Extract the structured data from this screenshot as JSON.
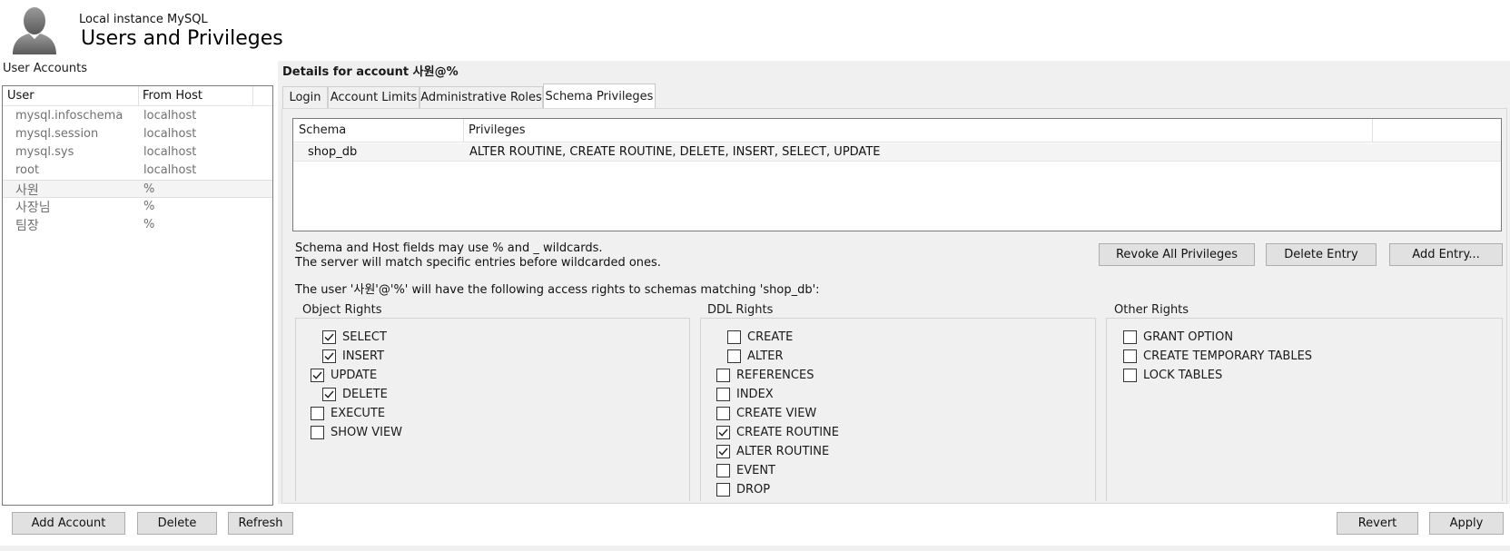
{
  "header": {
    "instance": "Local instance MySQL",
    "title": "Users and Privileges"
  },
  "accounts": {
    "label": "User Accounts",
    "columns": [
      "User",
      "From Host"
    ],
    "rows": [
      {
        "user": "mysql.infoschema",
        "host": "localhost",
        "selected": false
      },
      {
        "user": "mysql.session",
        "host": "localhost",
        "selected": false
      },
      {
        "user": "mysql.sys",
        "host": "localhost",
        "selected": false
      },
      {
        "user": "root",
        "host": "localhost",
        "selected": false
      },
      {
        "user": "사원",
        "host": "%",
        "selected": true
      },
      {
        "user": "사장님",
        "host": "%",
        "selected": false
      },
      {
        "user": "팀장",
        "host": "%",
        "selected": false
      }
    ],
    "buttons": {
      "add": "Add Account",
      "delete": "Delete",
      "refresh": "Refresh"
    }
  },
  "details": {
    "title": "Details for account 사원@%",
    "tabs": [
      "Login",
      "Account Limits",
      "Administrative Roles",
      "Schema Privileges"
    ],
    "active_tab": "Schema Privileges"
  },
  "schema_table": {
    "columns": [
      "Schema",
      "Privileges"
    ],
    "rows": [
      {
        "schema": "shop_db",
        "privileges": "ALTER ROUTINE, CREATE ROUTINE, DELETE, INSERT, SELECT, UPDATE"
      }
    ]
  },
  "notes": {
    "line1": "Schema and Host fields may use % and _ wildcards.",
    "line2": "The server will match specific entries before wildcarded ones.",
    "access": "The user '사원'@'%' will have the following access rights to schemas matching 'shop_db':"
  },
  "action_buttons": {
    "revoke": "Revoke All Privileges",
    "delete_entry": "Delete Entry",
    "add_entry": "Add Entry..."
  },
  "object_rights": {
    "title": "Object Rights",
    "items": [
      {
        "label": "SELECT",
        "checked": true
      },
      {
        "label": "INSERT",
        "checked": true
      },
      {
        "label": "UPDATE",
        "checked": true
      },
      {
        "label": "DELETE",
        "checked": true
      },
      {
        "label": "EXECUTE",
        "checked": false
      },
      {
        "label": "SHOW VIEW",
        "checked": false
      }
    ]
  },
  "ddl_rights": {
    "title": "DDL Rights",
    "items": [
      {
        "label": "CREATE",
        "checked": false
      },
      {
        "label": "ALTER",
        "checked": false
      },
      {
        "label": "REFERENCES",
        "checked": false
      },
      {
        "label": "INDEX",
        "checked": false
      },
      {
        "label": "CREATE VIEW",
        "checked": false
      },
      {
        "label": "CREATE ROUTINE",
        "checked": true
      },
      {
        "label": "ALTER ROUTINE",
        "checked": true
      },
      {
        "label": "EVENT",
        "checked": false
      },
      {
        "label": "DROP",
        "checked": false
      }
    ]
  },
  "other_rights": {
    "title": "Other Rights",
    "items": [
      {
        "label": "GRANT OPTION",
        "checked": false
      },
      {
        "label": "CREATE TEMPORARY TABLES",
        "checked": false
      },
      {
        "label": "LOCK TABLES",
        "checked": false
      }
    ]
  },
  "footer": {
    "revert": "Revert",
    "apply": "Apply"
  }
}
